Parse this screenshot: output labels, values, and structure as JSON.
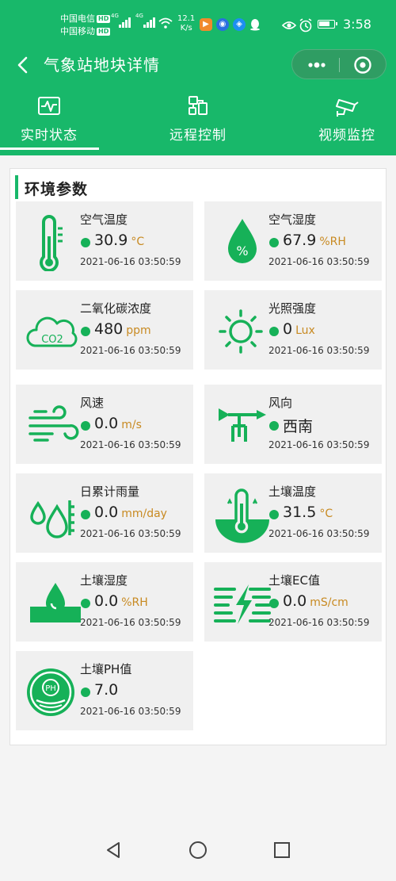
{
  "status_bar": {
    "carrier1": "中国电信",
    "carrier2": "中国移动",
    "hd": "HD",
    "net1": "4G",
    "net2": "4G",
    "speed_value": "12.1",
    "speed_unit": "K/s",
    "time": "3:58"
  },
  "header": {
    "title": "气象站地块详情"
  },
  "tabs": [
    {
      "label": "实时状态",
      "active": true
    },
    {
      "label": "远程控制",
      "active": false
    },
    {
      "label": "视频监控",
      "active": false
    }
  ],
  "section": {
    "title": "环境参数"
  },
  "sensors": [
    {
      "name": "空气温度",
      "value": "30.9",
      "unit": "°C",
      "time": "2021-06-16 03:50:59",
      "icon": "thermometer-icon"
    },
    {
      "name": "空气湿度",
      "value": "67.9",
      "unit": "%RH",
      "time": "2021-06-16 03:50:59",
      "icon": "humidity-drop-icon"
    },
    {
      "name": "二氧化碳浓度",
      "value": "480",
      "unit": "ppm",
      "time": "2021-06-16 03:50:59",
      "icon": "co2-cloud-icon"
    },
    {
      "name": "光照强度",
      "value": "0",
      "unit": "Lux",
      "time": "2021-06-16 03:50:59",
      "icon": "sun-icon"
    },
    {
      "name": "风速",
      "value": "0.0",
      "unit": "m/s",
      "time": "2021-06-16 03:50:59",
      "icon": "wind-icon"
    },
    {
      "name": "风向",
      "value": "西南",
      "unit": "",
      "time": "2021-06-16 03:50:59",
      "icon": "wind-vane-icon"
    },
    {
      "name": "日累计雨量",
      "value": "0.0",
      "unit": "mm/day",
      "time": "2021-06-16 03:50:59",
      "icon": "rain-gauge-icon"
    },
    {
      "name": "土壤温度",
      "value": "31.5",
      "unit": "°C",
      "time": "2021-06-16 03:50:59",
      "icon": "soil-thermometer-icon"
    },
    {
      "name": "土壤湿度",
      "value": "0.0",
      "unit": "%RH",
      "time": "2021-06-16 03:50:59",
      "icon": "soil-drop-icon"
    },
    {
      "name": "土壤EC值",
      "value": "0.0",
      "unit": "mS/cm",
      "time": "2021-06-16 03:50:59",
      "icon": "soil-ec-icon"
    },
    {
      "name": "土壤PH值",
      "value": "7.0",
      "unit": "",
      "time": "2021-06-16 03:50:59",
      "icon": "soil-ph-icon"
    }
  ],
  "icon_labels": {
    "co2": "CO2",
    "ph": "PH",
    "percent": "%"
  },
  "colors": {
    "brand_green": "#18b86a",
    "status_dot": "#16b158",
    "unit_text": "#c88a22"
  }
}
